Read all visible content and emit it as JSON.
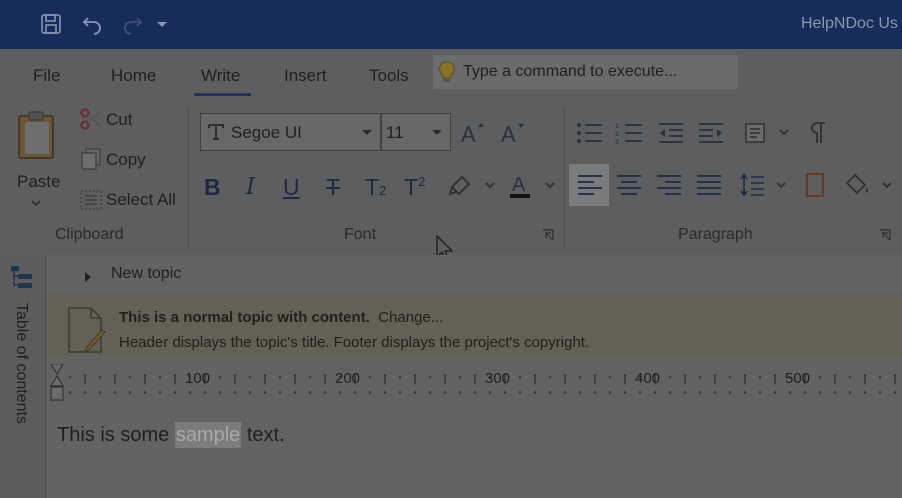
{
  "app": {
    "title": "HelpNDoc Us"
  },
  "ribbon": {
    "tabs": [
      "File",
      "Home",
      "Write",
      "Insert",
      "Tools"
    ],
    "active_tab": "Write",
    "command_placeholder": "Type a command to execute...",
    "clipboard": {
      "paste": "Paste",
      "cut": "Cut",
      "copy": "Copy",
      "select_all": "Select All",
      "group": "Clipboard"
    },
    "font": {
      "name": "Segoe UI",
      "size": "11",
      "group": "Font"
    },
    "paragraph": {
      "group": "Paragraph"
    }
  },
  "sidebar": {
    "toc_label": "Table of contents"
  },
  "editor": {
    "topic_title": "New topic",
    "info_bold": "This is a normal topic with content.",
    "info_change": "Change...",
    "info_detail": "Header displays the topic's title.  Footer displays the project's copyright.",
    "ruler_labels": [
      "100",
      "200",
      "300",
      "400",
      "500"
    ],
    "text_before": "This is some ",
    "text_selected": "sample",
    "text_after": " text."
  },
  "colors": {
    "titlebar": "#172c58",
    "accent": "#23335a"
  }
}
